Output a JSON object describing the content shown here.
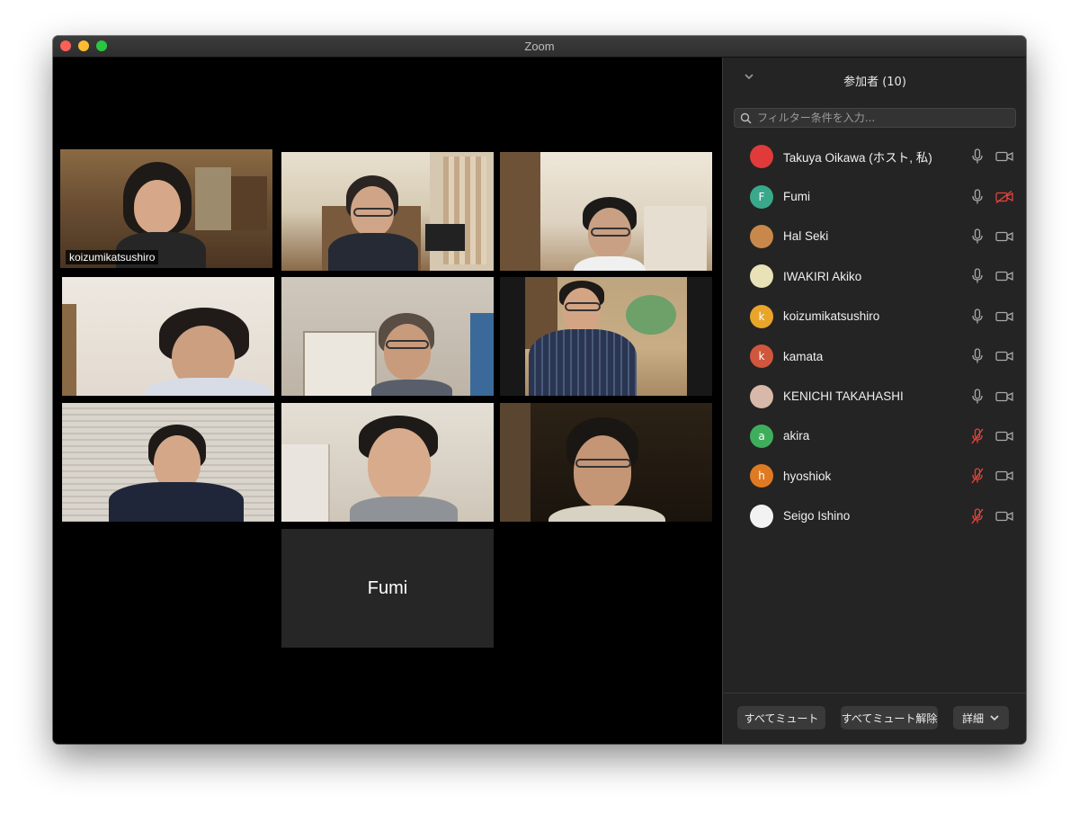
{
  "window": {
    "title": "Zoom"
  },
  "gallery": {
    "active_speaker_name": "koizumikatsushiro",
    "no_video_name": "Fumi"
  },
  "panel": {
    "title": "参加者 (10)",
    "search_placeholder": "フィルター条件を入力...",
    "participants": [
      {
        "name": "Takuya Oikawa (ホスト, 私)",
        "avatar_text": "",
        "avatar_color": "#e03a3a",
        "mic_muted": false,
        "video_off": false
      },
      {
        "name": "Fumi",
        "avatar_text": "F",
        "avatar_color": "#3aa88a",
        "mic_muted": false,
        "video_off": true
      },
      {
        "name": "Hal Seki",
        "avatar_text": "",
        "avatar_color": "#c9884b",
        "mic_muted": false,
        "video_off": false
      },
      {
        "name": "IWAKIRI Akiko",
        "avatar_text": "",
        "avatar_color": "#e9e2b8",
        "mic_muted": false,
        "video_off": false
      },
      {
        "name": "koizumikatsushiro",
        "avatar_text": "k",
        "avatar_color": "#e8a52a",
        "mic_muted": false,
        "video_off": false
      },
      {
        "name": "kamata",
        "avatar_text": "k",
        "avatar_color": "#d0563d",
        "mic_muted": false,
        "video_off": false
      },
      {
        "name": "KENICHI TAKAHASHI",
        "avatar_text": "",
        "avatar_color": "#d8b8a8",
        "mic_muted": false,
        "video_off": false
      },
      {
        "name": "akira",
        "avatar_text": "a",
        "avatar_color": "#3fae5c",
        "mic_muted": true,
        "video_off": false
      },
      {
        "name": "hyoshiok",
        "avatar_text": "h",
        "avatar_color": "#e07a22",
        "mic_muted": true,
        "video_off": false
      },
      {
        "name": "Seigo Ishino",
        "avatar_text": "",
        "avatar_color": "#f2f2f2",
        "mic_muted": true,
        "video_off": false
      }
    ]
  },
  "footer": {
    "mute_all_label": "すべてミュート",
    "unmute_all_label": "すべてミュート解除",
    "more_label": "詳細"
  },
  "colors": {
    "active_speaker_border": "#d7e86a",
    "muted_red": "#e0443b",
    "panel_bg": "#242424"
  }
}
